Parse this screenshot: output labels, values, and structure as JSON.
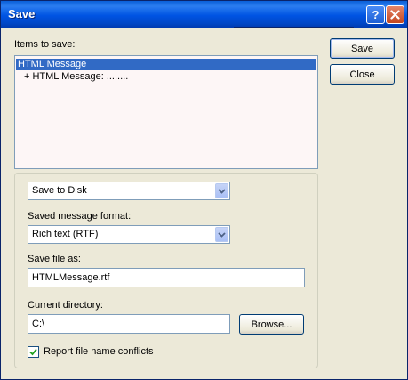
{
  "window": {
    "title": "Save"
  },
  "icons": {
    "help": "question-icon",
    "close": "close-x-icon",
    "dropdown": "chevron-down-icon",
    "check": "checkmark-icon"
  },
  "items_label": "Items to save:",
  "items": [
    {
      "label": "HTML Message",
      "selected": true
    },
    {
      "label": "+ HTML Message: ........",
      "selected": false
    }
  ],
  "buttons": {
    "save": "Save",
    "close": "Close",
    "browse": "Browse..."
  },
  "destination": {
    "value": "Save to Disk"
  },
  "format": {
    "label": "Saved message format:",
    "value": "Rich text (RTF)"
  },
  "save_as": {
    "label": "Save file as:",
    "value": "HTMLMessage.rtf"
  },
  "directory": {
    "label": "Current directory:",
    "value": "C:\\"
  },
  "report_conflicts": {
    "label": "Report file name conflicts",
    "checked": true
  },
  "colors": {
    "titlebar": "#0054e3",
    "selection": "#316ac5",
    "face": "#ece9d8"
  }
}
